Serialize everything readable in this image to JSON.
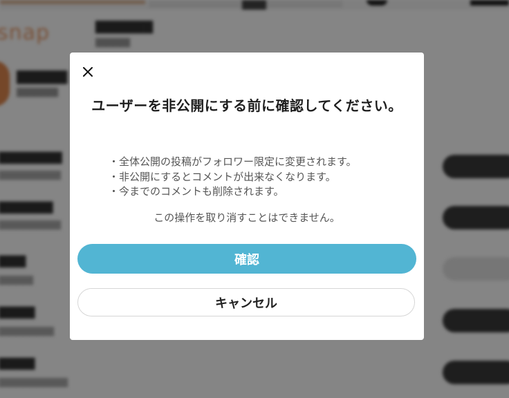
{
  "modal": {
    "title": "ユーザーを非公開にする前に確認してください。",
    "bullets": [
      "・全体公開の投稿がフォロワー限定に変更されます。",
      "・非公開にするとコメントが出来なくなります。",
      "・今までのコメントも削除されます。"
    ],
    "note": "この操作を取り消すことはできません。",
    "confirm_label": "確認",
    "cancel_label": "キャンセル",
    "close_icon": "close-icon",
    "confirm_color": "#52b5d3"
  }
}
